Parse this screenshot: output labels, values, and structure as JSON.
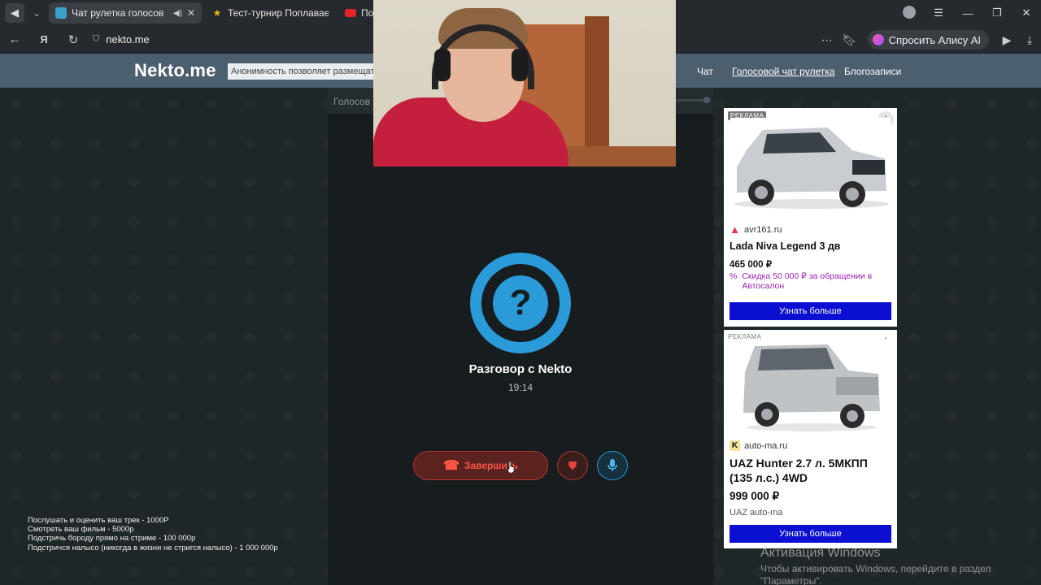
{
  "browser": {
    "tabs": [
      {
        "title": "Чат рулетка голосов",
        "active": true,
        "favicon_color": "#3aa0c8"
      },
      {
        "title": "Тест-турнир Поплаваешь",
        "active": false,
        "favicon_color": "#e2b812"
      },
      {
        "title": "Побо",
        "active": false,
        "favicon_color": "#e3222a"
      }
    ],
    "url": "nekto.me",
    "alice_button": "Спросить Алису AI"
  },
  "site": {
    "logo": "Nekto.me",
    "marquee": "Анонимность позволяет размещать инф",
    "nav": [
      {
        "label": "Чат",
        "underlined": false
      },
      {
        "label": "Голосовой чат рулетка",
        "underlined": true
      },
      {
        "label": "Блогозаписи",
        "underlined": false
      }
    ]
  },
  "call": {
    "panel_title": "Голосов",
    "caller_symbol": "?",
    "title": "Разговор с Nekto",
    "timer": "19:14",
    "end_label": "Завершить",
    "accent_color": "#2a9bd8",
    "danger_color": "#ff5545"
  },
  "ads": [
    {
      "label": "РЕКЛАМА",
      "domain": "avr161.ru",
      "title": "Lada Niva Legend 3 дв",
      "price": "465 000 ₽",
      "promo": "Скидка 50 000 ₽ за обращении в Автосалон",
      "button": "Узнать больше"
    },
    {
      "label": "РЕКЛАМА",
      "domain": "auto-ma.ru",
      "title": "UAZ Hunter 2.7 л. 5МКПП (135 л.с.) 4WD",
      "price": "999 000 ₽",
      "subtitle": "UAZ auto-ma",
      "button": "Узнать больше"
    }
  ],
  "donations": [
    "Послушать и оценить ваш трек - 1000Р",
    "Смотреть ваш фильм - 5000р",
    "Подстричь бороду прямо на стриме - 100 000р",
    "Подстричся налысо (никогда в жизни не стригся налысо) - 1 000 000р"
  ],
  "windows_activation": {
    "title": "Активация Windows",
    "line1": "Чтобы активировать Windows, перейдите в раздел",
    "line2": "\"Параметры\"."
  }
}
